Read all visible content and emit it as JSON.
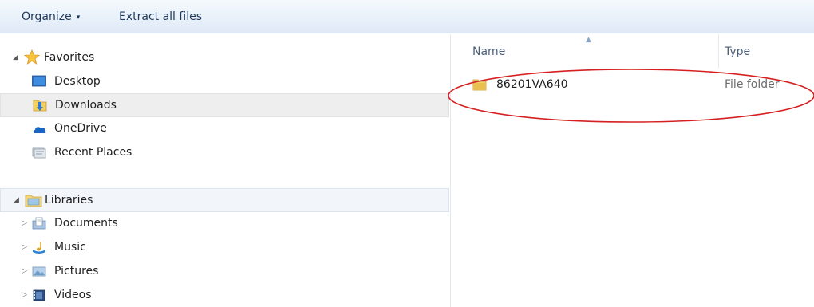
{
  "toolbar": {
    "organize_label": "Organize",
    "organize_caret": "▾",
    "extract_label": "Extract all files"
  },
  "nav": {
    "favorites": {
      "label": "Favorites",
      "items": [
        {
          "label": "Desktop",
          "icon": "desktop-icon"
        },
        {
          "label": "Downloads",
          "icon": "downloads-folder-icon",
          "selected": true
        },
        {
          "label": "OneDrive",
          "icon": "onedrive-cloud-icon"
        },
        {
          "label": "Recent Places",
          "icon": "recent-places-icon"
        }
      ]
    },
    "libraries": {
      "label": "Libraries",
      "items": [
        {
          "label": "Documents",
          "icon": "documents-library-icon"
        },
        {
          "label": "Music",
          "icon": "music-library-icon"
        },
        {
          "label": "Pictures",
          "icon": "pictures-library-icon"
        },
        {
          "label": "Videos",
          "icon": "videos-library-icon"
        }
      ]
    },
    "expanded_arrow": "◢",
    "collapsed_arrow": "▷"
  },
  "content": {
    "columns": {
      "name": "Name",
      "type": "Type"
    },
    "sort_indicator": "▲",
    "files": [
      {
        "name": "86201VA640",
        "type": "File folder",
        "icon": "folder-icon"
      }
    ]
  },
  "colors": {
    "toolbar_text": "#1e395b",
    "highlight_oval": "#d62020",
    "selection_bg": "#eeeeee"
  }
}
